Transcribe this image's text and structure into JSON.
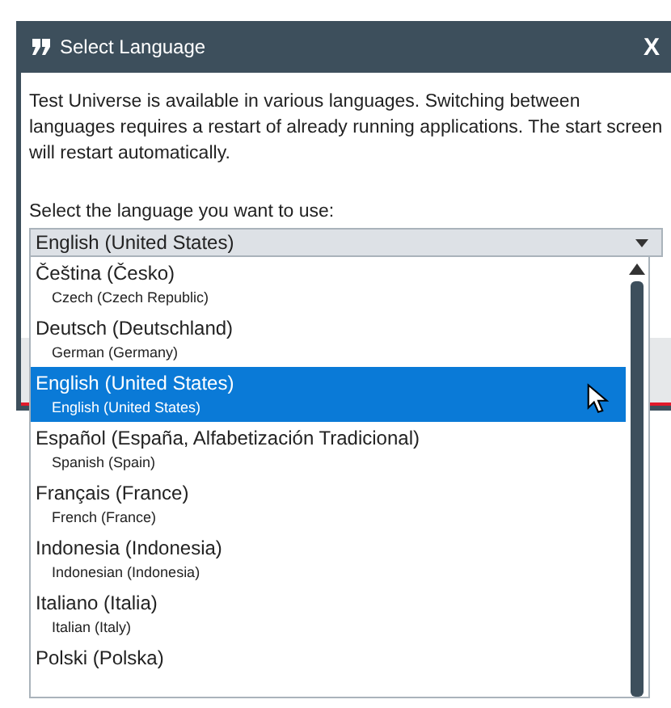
{
  "window": {
    "title": "Select Language",
    "close": "X"
  },
  "description": "Test Universe is available in various languages. Switching between languages requires a restart of already running applications. The start screen will restart automatically.",
  "prompt": "Select the language you want to use:",
  "dropdown": {
    "value": "English (United States)"
  },
  "languages": [
    {
      "native": "Čeština (Česko)",
      "english": "Czech (Czech Republic)",
      "selected": false
    },
    {
      "native": "Deutsch (Deutschland)",
      "english": "German (Germany)",
      "selected": false
    },
    {
      "native": "English (United States)",
      "english": "English (United States)",
      "selected": true
    },
    {
      "native": "Español (España, Alfabetización Tradicional)",
      "english": "Spanish (Spain)",
      "selected": false
    },
    {
      "native": "Français (France)",
      "english": "French (France)",
      "selected": false
    },
    {
      "native": "Indonesia (Indonesia)",
      "english": "Indonesian (Indonesia)",
      "selected": false
    },
    {
      "native": "Italiano (Italia)",
      "english": "Italian (Italy)",
      "selected": false
    },
    {
      "native": "Polski (Polska)",
      "selected": false
    }
  ]
}
